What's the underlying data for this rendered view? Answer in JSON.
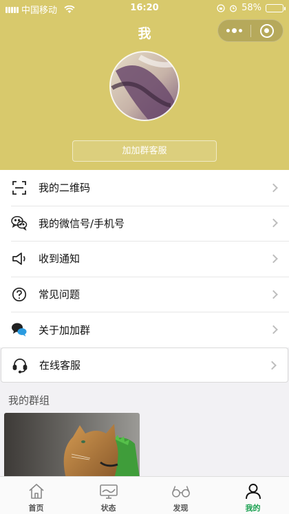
{
  "status_bar": {
    "carrier": "中国移动",
    "time": "16:20",
    "battery_text": "58%",
    "battery_level": 0.58
  },
  "header": {
    "title": "我",
    "nickname": "加加群客服",
    "background_color": "#d8c96c"
  },
  "menu": {
    "items": [
      {
        "label": "我的二维码",
        "icon": "qr-scan-icon"
      },
      {
        "label": "我的微信号/手机号",
        "icon": "wechat-icon"
      },
      {
        "label": "收到通知",
        "icon": "speaker-icon"
      },
      {
        "label": "常见问题",
        "icon": "question-icon"
      },
      {
        "label": "关于加加群",
        "icon": "chat-bubbles-icon"
      }
    ],
    "service": {
      "label": "在线客服",
      "icon": "headset-icon"
    }
  },
  "groups": {
    "section_title": "我的群组"
  },
  "tabbar": {
    "active_color": "#19a04f",
    "tabs": [
      {
        "label": "首页",
        "icon": "home-icon"
      },
      {
        "label": "状态",
        "icon": "monitor-icon"
      },
      {
        "label": "发现",
        "icon": "glasses-icon"
      },
      {
        "label": "我的",
        "icon": "person-icon",
        "active": true
      }
    ]
  }
}
